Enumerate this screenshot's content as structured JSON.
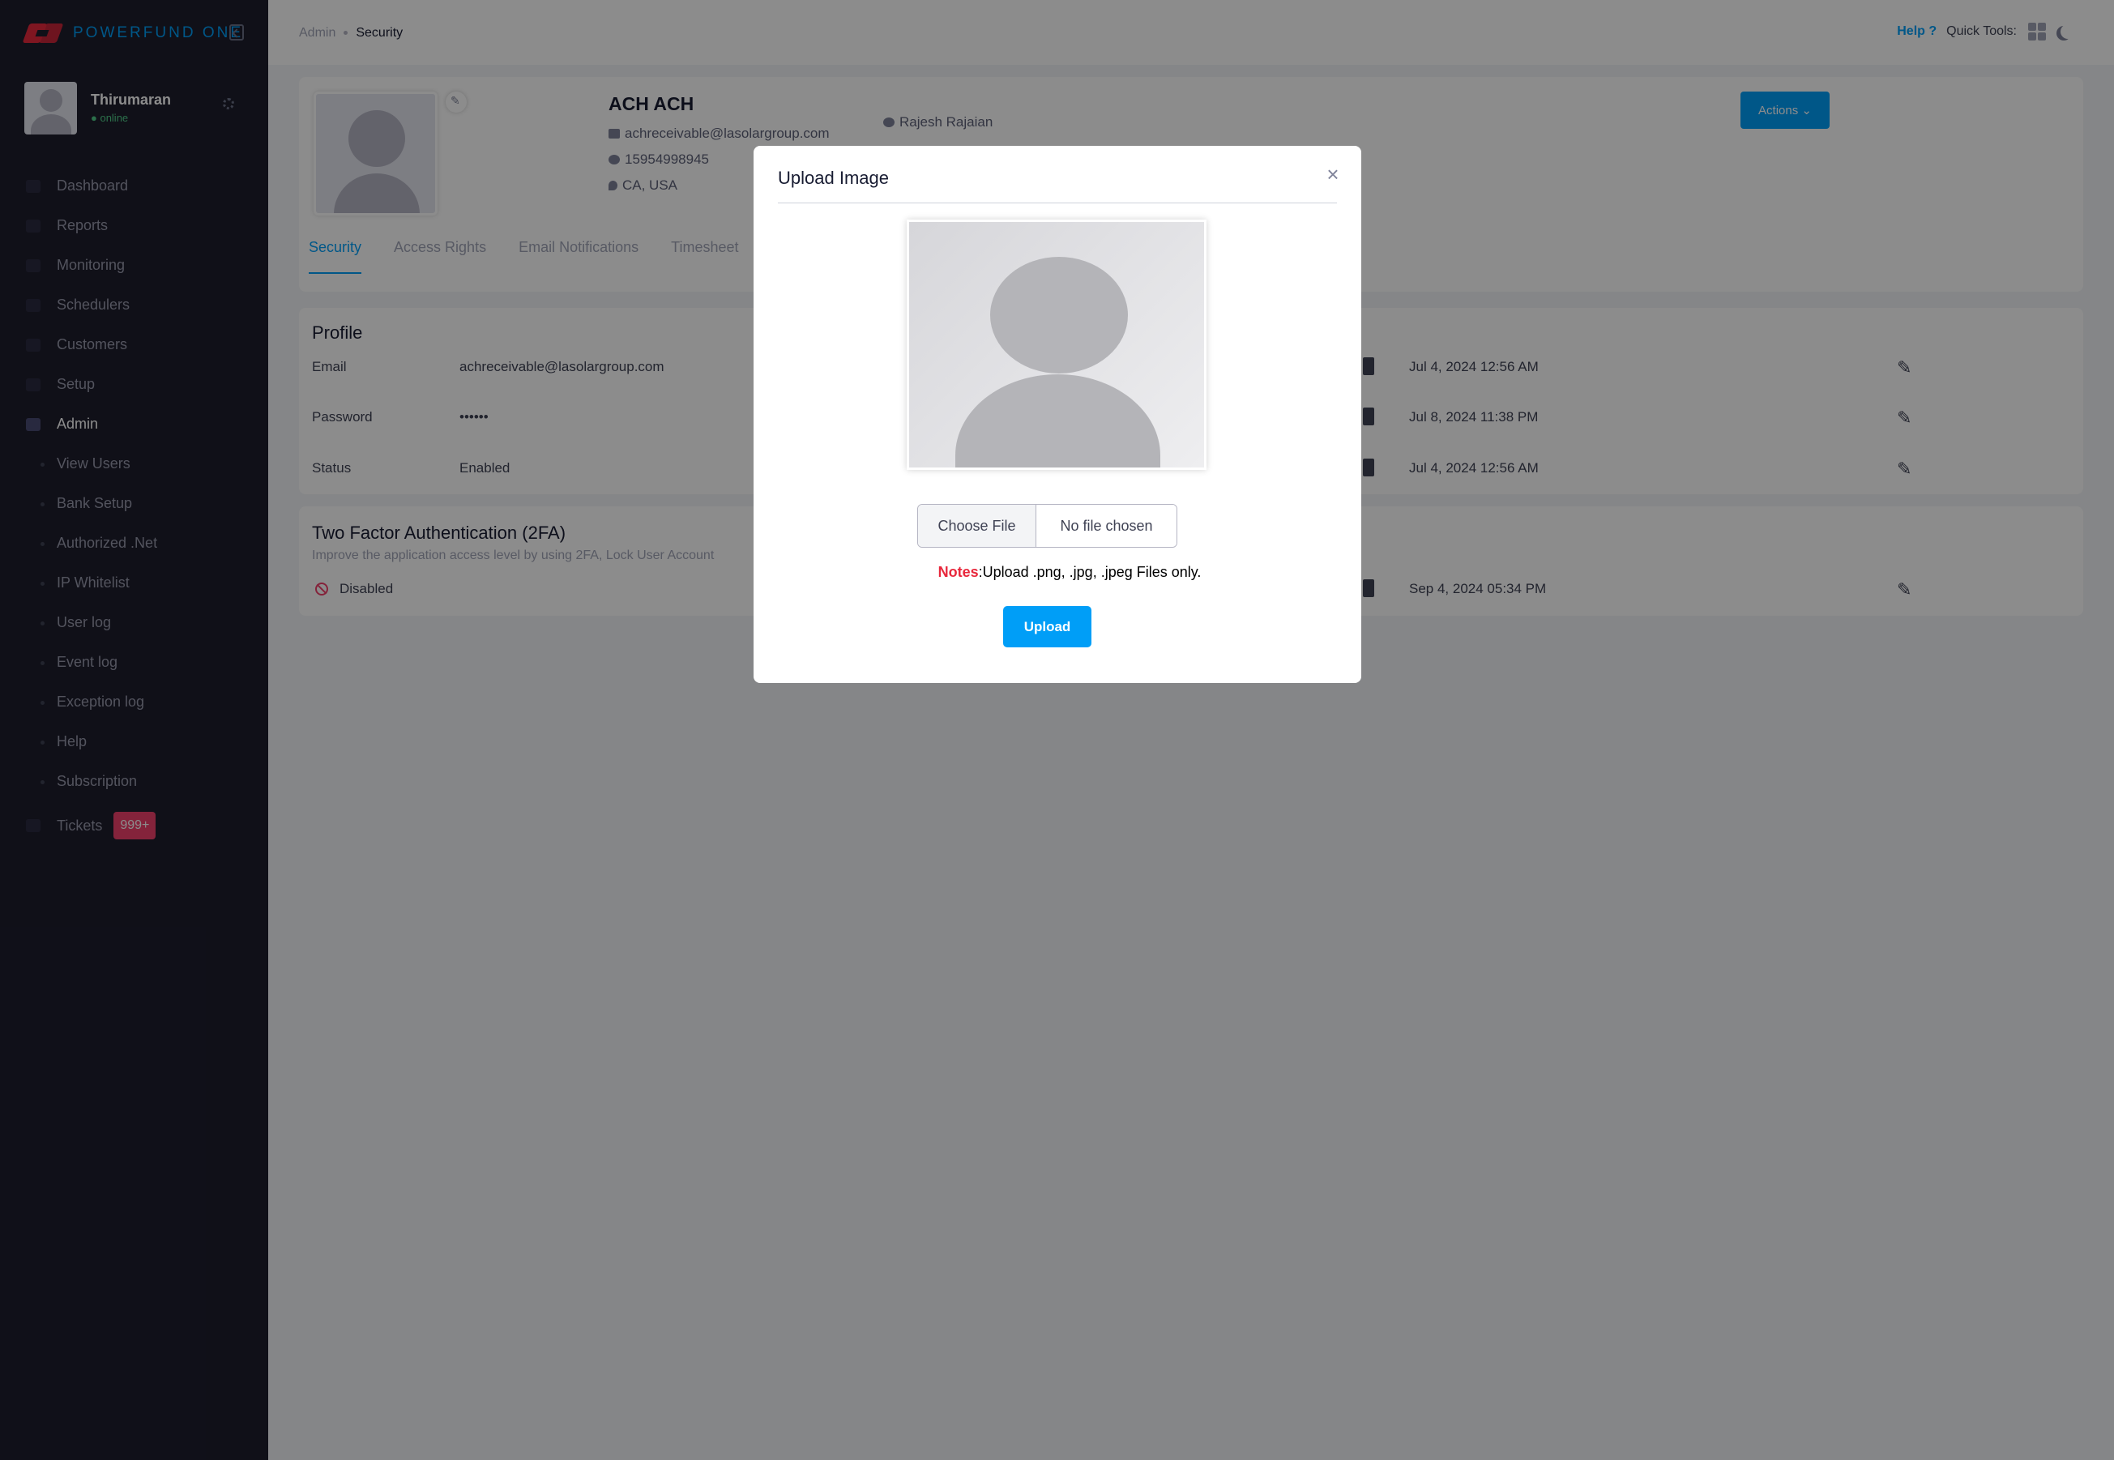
{
  "brand": {
    "name": "POWERFUND ONE"
  },
  "user": {
    "name": "Thirumaran",
    "status": "● online"
  },
  "nav": {
    "main": [
      {
        "label": "Dashboard",
        "icon": "home-icon"
      },
      {
        "label": "Reports",
        "icon": "chart-icon"
      },
      {
        "label": "Monitoring",
        "icon": "monitor-icon"
      },
      {
        "label": "Schedulers",
        "icon": "scheduler-icon"
      },
      {
        "label": "Customers",
        "icon": "user-icon"
      },
      {
        "label": "Setup",
        "icon": "setup-icon"
      },
      {
        "label": "Admin",
        "icon": "admin-icon"
      }
    ],
    "admin_sub": [
      {
        "label": "View Users"
      },
      {
        "label": "Bank Setup"
      },
      {
        "label": "Authorized .Net"
      },
      {
        "label": "IP Whitelist"
      },
      {
        "label": "User log"
      },
      {
        "label": "Event log"
      },
      {
        "label": "Exception log"
      },
      {
        "label": "Help"
      },
      {
        "label": "Subscription"
      }
    ],
    "tickets": {
      "label": "Tickets",
      "badge": "999+"
    }
  },
  "header": {
    "breadcrumb": [
      "Admin",
      "Security"
    ],
    "help": "Help ?",
    "quick_tools": "Quick Tools:"
  },
  "profile": {
    "name": "ACH ACH",
    "email": "achreceivable@lasolargroup.com",
    "phone": "15954998945",
    "location": "CA, USA",
    "manager": "Rajesh Rajaian",
    "actions_label": "Actions ⌄",
    "tabs": [
      "Security",
      "Access Rights",
      "Email Notifications",
      "Timesheet"
    ]
  },
  "details": {
    "title": "Profile",
    "rows": [
      {
        "label": "Email",
        "value": "achreceivable@lasolargroup.com",
        "date": "Jul 4, 2024 12:56 AM"
      },
      {
        "label": "Password",
        "value": "••••••",
        "date": "Jul 8, 2024 11:38 PM"
      },
      {
        "label": "Status",
        "value": "Enabled",
        "date": "Jul 4, 2024 12:56 AM"
      }
    ]
  },
  "twofa": {
    "title": "Two Factor Authentication (2FA)",
    "description": "Improve the application access level by using 2FA, Lock User Account",
    "status": "Disabled",
    "date": "Sep 4, 2024 05:34 PM"
  },
  "modal": {
    "title": "Upload Image",
    "close": "×",
    "choose_file": "Choose File",
    "file_status": "No file chosen",
    "notes_label": "Notes",
    "notes_text": ":Upload .png, .jpg, .jpeg Files only.",
    "upload": "Upload"
  }
}
